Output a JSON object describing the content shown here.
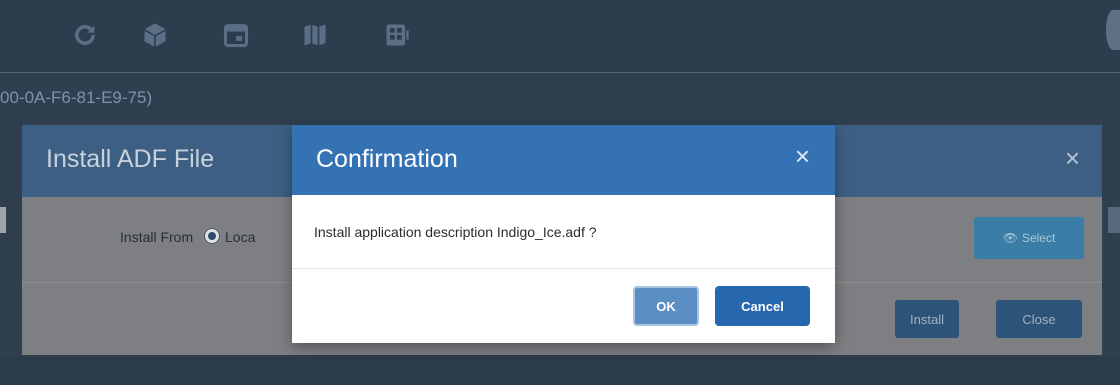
{
  "toolbar": {
    "icons": [
      "refresh-icon",
      "box-icon",
      "calendar-icon",
      "map-icon",
      "dashboard-icon"
    ]
  },
  "subheader": {
    "text": "00-0A-F6-81-E9-75)"
  },
  "adf_modal": {
    "title": "Install ADF File",
    "close_glyph": "×",
    "install_from_label": "Install From",
    "radio_label": "Loca",
    "select_button": "Select",
    "install_button": "Install",
    "close_button": "Close"
  },
  "confirm_dialog": {
    "title": "Confirmation",
    "close_glyph": "×",
    "message": "Install application description Indigo_Ice.adf ?",
    "ok_button": "OK",
    "cancel_button": "Cancel"
  },
  "colors": {
    "dialog_header": "#3472b4",
    "primary_button": "#2767ad",
    "app_background": "#2f3f4f"
  }
}
